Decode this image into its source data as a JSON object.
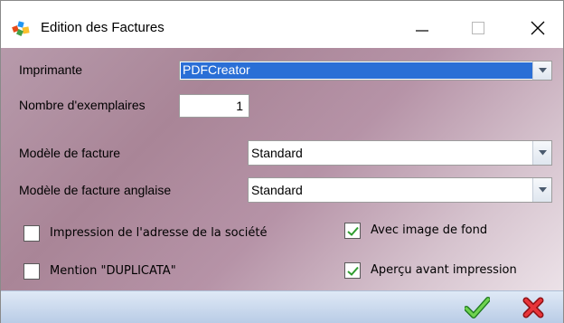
{
  "window": {
    "title": "Edition des Factures",
    "controls": {
      "minimize": "minimize",
      "maximize": "maximize",
      "close": "close"
    }
  },
  "printer": {
    "label": "Imprimante",
    "value": "PDFCreator"
  },
  "copies": {
    "label": "Nombre d'exemplaires",
    "value": "1"
  },
  "invoice_model": {
    "label": "Modèle de facture",
    "value": "Standard"
  },
  "invoice_model_en": {
    "label": "Modèle de facture anglaise",
    "value": "Standard"
  },
  "options": {
    "print_address": {
      "label": "Impression de l'adresse de la société",
      "checked": false
    },
    "duplicata": {
      "label": "Mention \"DUPLICATA\"",
      "checked": false
    },
    "background_image": {
      "label": "Avec image de fond",
      "checked": true
    },
    "preview": {
      "label": "Aperçu avant impression",
      "checked": true
    }
  },
  "colors": {
    "accent": "#2a6fd6",
    "check_green": "#2e9c2e",
    "cancel_red": "#d8252b"
  },
  "icons": {
    "ok": "green-check-icon",
    "cancel": "red-x-icon",
    "dropdown": "chevron-down-icon"
  }
}
